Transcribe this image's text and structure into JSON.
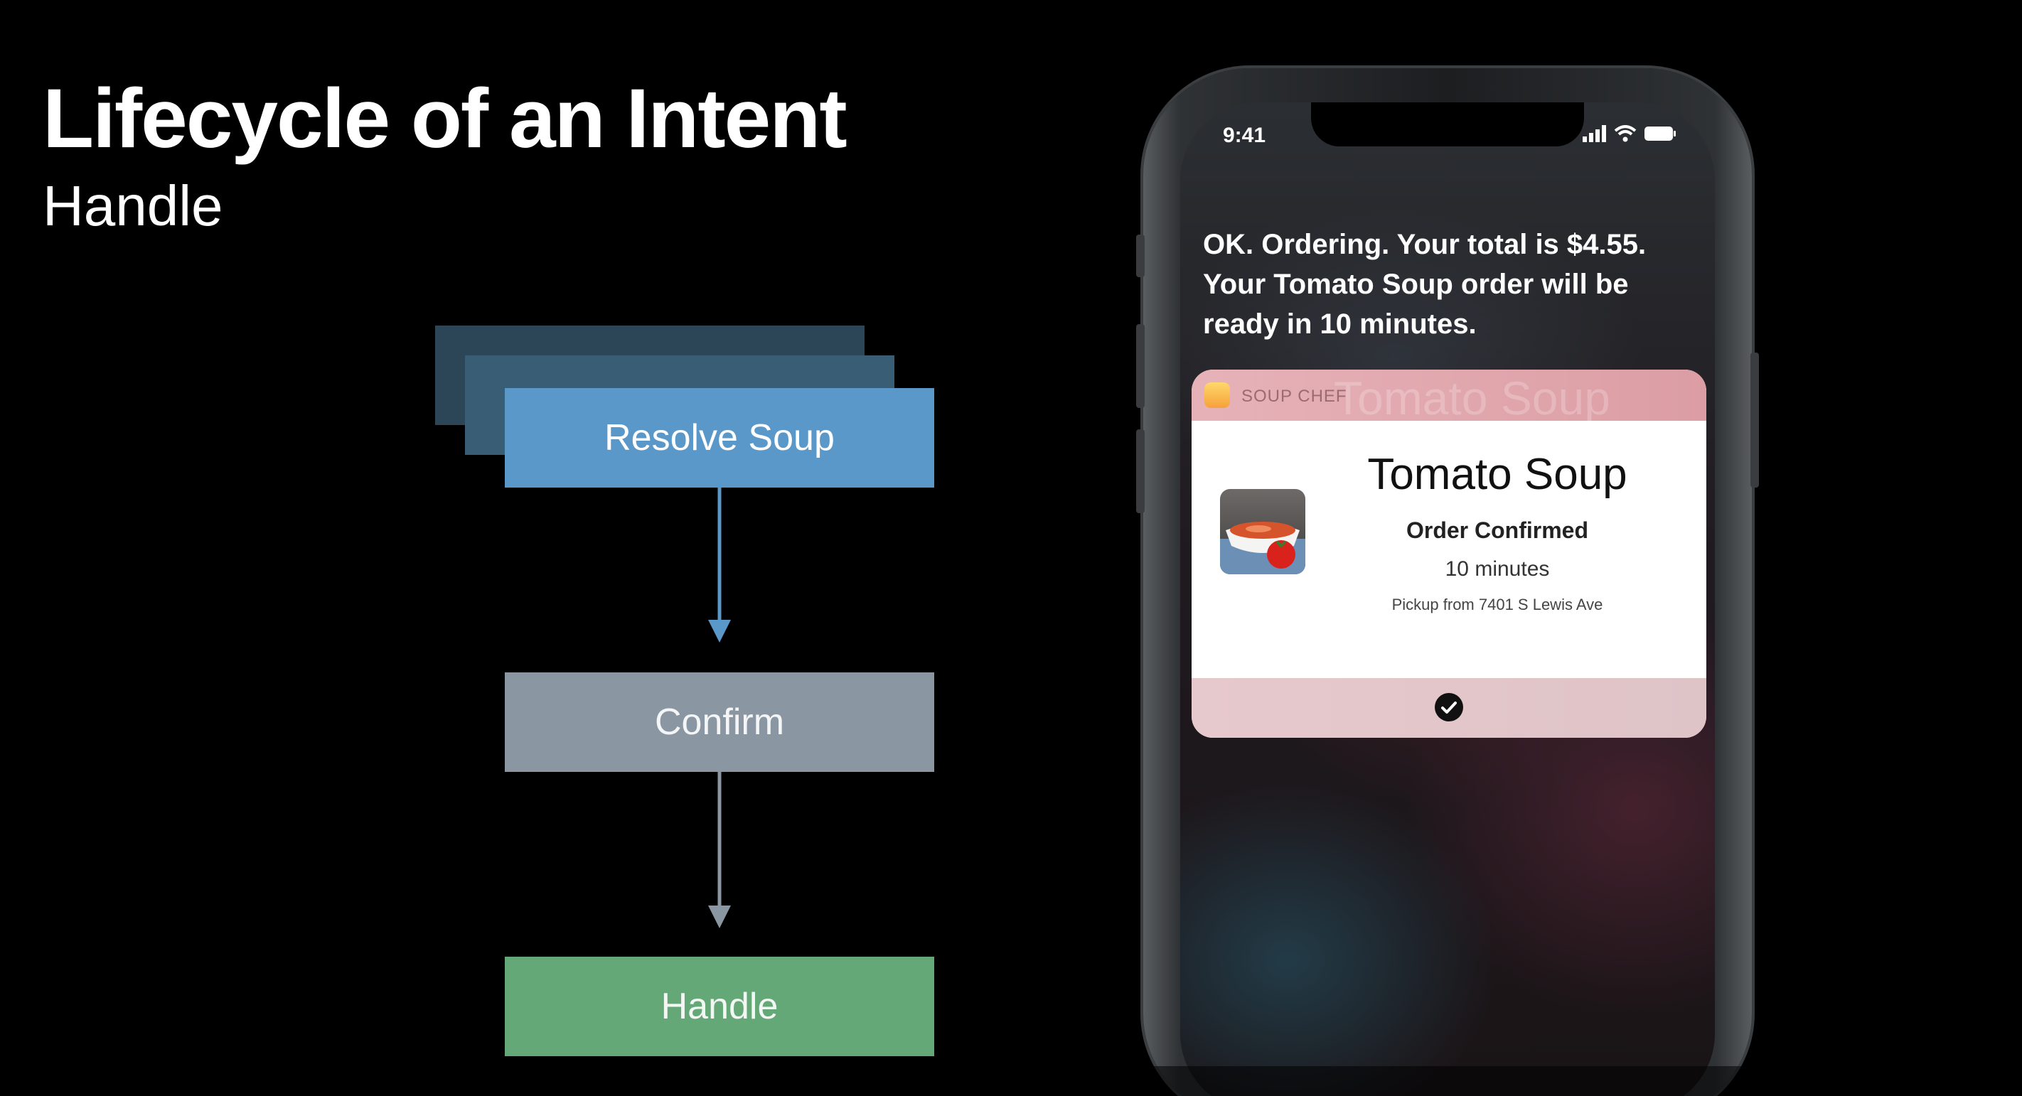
{
  "slide": {
    "title": "Lifecycle of an Intent",
    "subtitle": "Handle"
  },
  "flow": {
    "steps": [
      {
        "label": "Resolve Soup",
        "color": "#5a98c9"
      },
      {
        "label": "Confirm",
        "color": "#8a96a1"
      },
      {
        "label": "Handle",
        "color": "#65a878"
      }
    ],
    "arrow_colors": [
      "#5a98c9",
      "#8a96a1"
    ]
  },
  "phone": {
    "status_time": "9:41",
    "status_icons": [
      "cellular-signal-icon",
      "wifi-icon",
      "battery-icon"
    ],
    "siri_response": "OK. Ordering. Your total is $4.55. Your Tomato Soup order will be ready in 10 minutes.",
    "card": {
      "app_name": "SOUP CHEF",
      "ghost_title": "Tomato Soup",
      "title": "Tomato Soup",
      "status": "Order Confirmed",
      "time": "10 minutes",
      "pickup": "Pickup from 7401 S Lewis Ave",
      "footer_icon": "checkmark-circle-icon",
      "header_color": "#dc9da4"
    }
  }
}
